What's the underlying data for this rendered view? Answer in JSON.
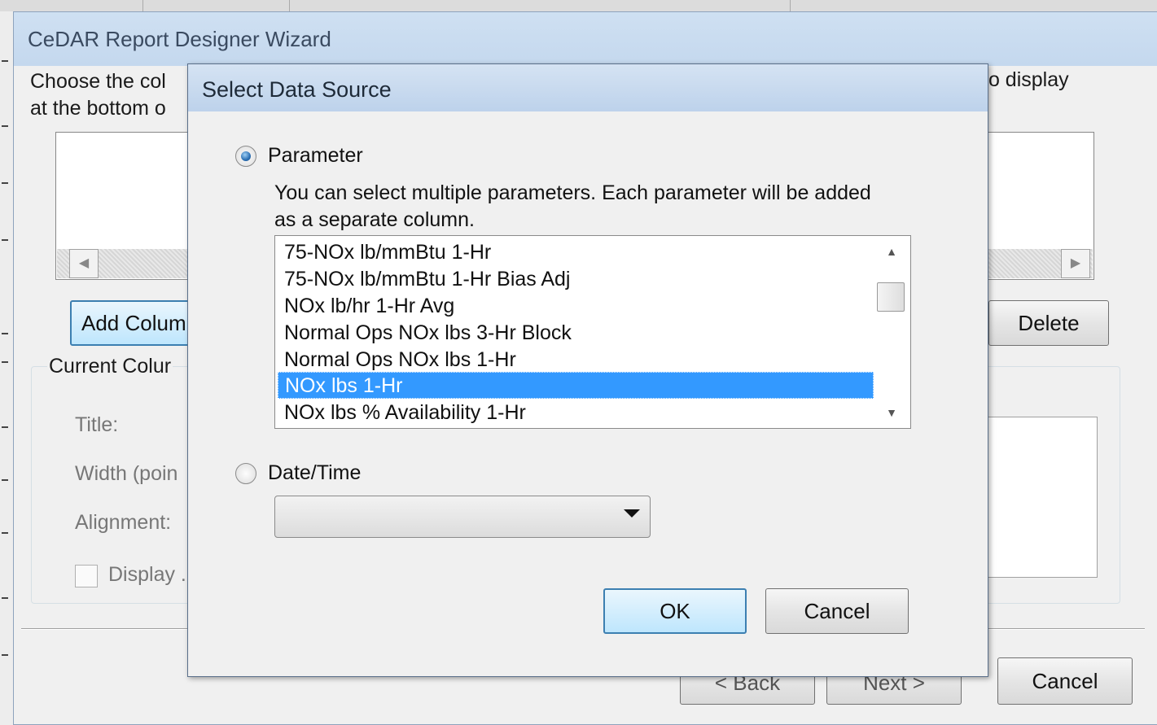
{
  "wizard": {
    "title": "CeDAR Report Designer Wizard",
    "instruction_line1": "Choose the col",
    "instruction_line2": "at the bottom o",
    "instruction_right": "to display",
    "add_column_label": "Add Colum",
    "delete_label": "Delete",
    "current_column_legend": "Current Colur",
    "title_label": "Title:",
    "width_label": "Width (poin",
    "alignment_label": "Alignment:",
    "display_label": "Display .",
    "back_label": "< Back",
    "next_label": "Next >",
    "cancel_label": "Cancel"
  },
  "dialog": {
    "title": "Select Data Source",
    "parameter_label": "Parameter",
    "description_line1": "You can select multiple parameters. Each parameter will be added",
    "description_line2": "as a separate column.",
    "parameters": [
      "75-NOx lb/mmBtu 1-Hr",
      "75-NOx lb/mmBtu 1-Hr Bias Adj",
      "NOx lb/hr 1-Hr Avg",
      "Normal Ops NOx lbs 3-Hr Block",
      "Normal Ops NOx lbs 1-Hr",
      "NOx lbs 1-Hr",
      "NOx lbs % Availability 1-Hr"
    ],
    "selected_index": 5,
    "datetime_label": "Date/Time",
    "datetime_value": "",
    "ok_label": "OK",
    "cancel_label": "Cancel"
  },
  "colors": {
    "selection": "#3399ff",
    "titlebar": "#c4d8ee",
    "radio_checked": "#2b6fb3"
  }
}
